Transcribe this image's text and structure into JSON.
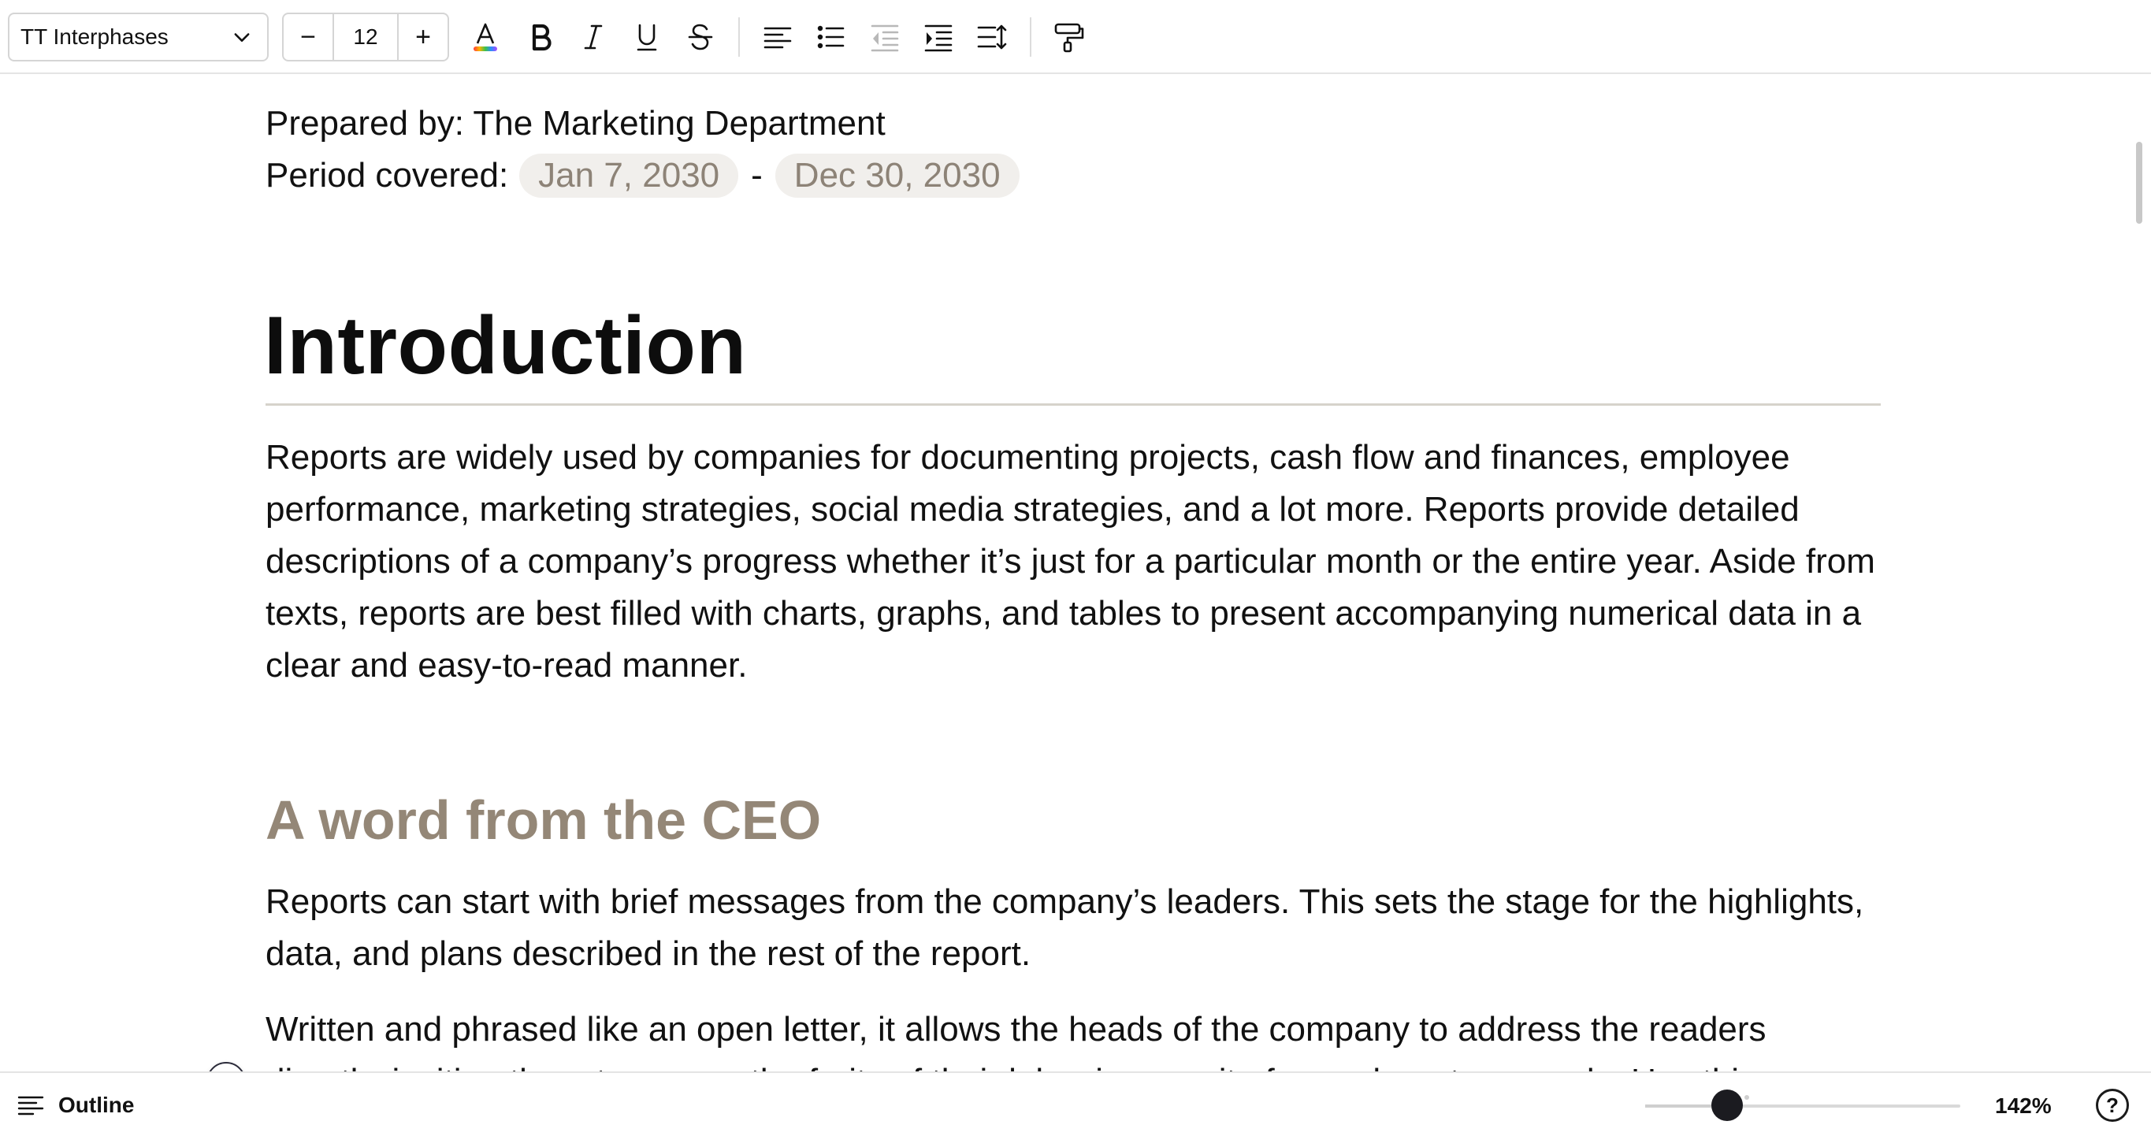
{
  "toolbar": {
    "font_family": "TT Interphases",
    "font_size": "12",
    "decrease_label": "−",
    "increase_label": "+",
    "icons": [
      "text-color-icon",
      "bold-icon",
      "italic-icon",
      "underline-icon",
      "strikethrough-icon",
      "align-left-icon",
      "bullet-list-icon",
      "outdent-icon",
      "indent-icon",
      "line-spacing-icon",
      "format-painter-icon"
    ]
  },
  "doc": {
    "prepared_by": "Prepared by: The Marketing Department",
    "period_label": "Period covered:",
    "period_start": "Jan 7, 2030",
    "period_dash": "-",
    "period_end": "Dec 30, 2030",
    "heading_intro": "Introduction",
    "para_intro": "Reports are widely used by companies for documenting projects, cash flow and finances, employee performance, marketing strategies, social media strategies, and a lot more. Reports provide detailed descriptions of a company’s progress whether it’s just for a particular month or the entire year. Aside from texts, reports are best filled with charts, graphs, and tables to present accompanying numerical data in a clear and easy-to-read manner.",
    "heading_ceo": "A word from the CEO",
    "para_ceo_1": "Reports can start with brief messages from the company’s leaders. This sets the stage for the highlights, data, and plans described in the rest of the report.",
    "para_ceo_2": "Written and phrased like an open letter, it allows the heads of the company to address the readers directly, inviting them to peruse the fruits of their labor in pursuit of more long-term goals. Use this space to connect, engage, and get the readers excited about the information to come."
  },
  "bottombar": {
    "outline_label": "Outline",
    "zoom_level": "142%",
    "zoom_fraction": 0.26,
    "help_label": "?"
  },
  "colors": {
    "heading_accent": "#948777",
    "date_chip_bg": "#f1efec",
    "date_chip_text": "#8d8377"
  }
}
